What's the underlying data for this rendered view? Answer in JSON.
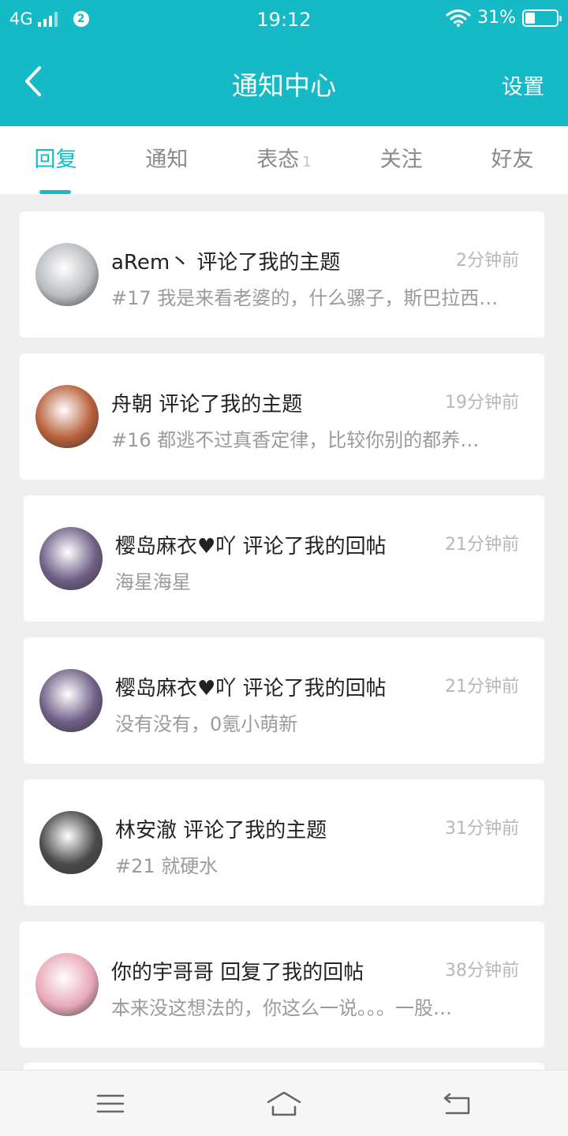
{
  "status_bar": {
    "network": "4G",
    "sim_badge": "2",
    "time": "19:12",
    "battery_percent_text": "31%",
    "battery_level": 0.31,
    "icons": [
      "signal-icon",
      "wifi-icon",
      "battery-icon"
    ]
  },
  "app_bar": {
    "title": "通知中心",
    "settings_label": "设置",
    "back_icon": "chevron-left-icon"
  },
  "tabs": [
    {
      "label": "回复",
      "badge": "",
      "active": true
    },
    {
      "label": "通知",
      "badge": "",
      "active": false
    },
    {
      "label": "表态",
      "badge": "1",
      "active": false
    },
    {
      "label": "关注",
      "badge": "",
      "active": false
    },
    {
      "label": "好友",
      "badge": "",
      "active": false
    }
  ],
  "notifications": [
    {
      "headline": "aRem丶 评论了我的主题",
      "time": "2分钟前",
      "preview": "#17 我是来看老婆的，什么骡子，斯巴拉西…",
      "avatar_color": "#b9bcc0"
    },
    {
      "headline": "舟朝 评论了我的主题",
      "time": "19分钟前",
      "preview": "#16 都逃不过真香定律，比较你别的都养…",
      "avatar_color": "#b8603a"
    },
    {
      "headline": "樱岛麻衣♥吖 评论了我的回帖",
      "time": "21分钟前",
      "preview": "海星海星",
      "avatar_color": "#6f5f86"
    },
    {
      "headline": "樱岛麻衣♥吖 评论了我的回帖",
      "time": "21分钟前",
      "preview": "没有没有，0氪小萌新",
      "avatar_color": "#6f5f86"
    },
    {
      "headline": "林安澈 评论了我的主题",
      "time": "31分钟前",
      "preview": "#21 就硬水",
      "avatar_color": "#4a4a4a"
    },
    {
      "headline": "你的宇哥哥 回复了我的回帖",
      "time": "38分钟前",
      "preview": "本来没这想法的，你这么一说。。。一股…",
      "avatar_color": "#e9a9b8"
    }
  ],
  "nav_bar": {
    "icons": [
      "menu-icon",
      "home-icon",
      "back-icon"
    ]
  },
  "colors": {
    "accent": "#16b9c6",
    "background": "#efefef",
    "card": "#ffffff"
  }
}
